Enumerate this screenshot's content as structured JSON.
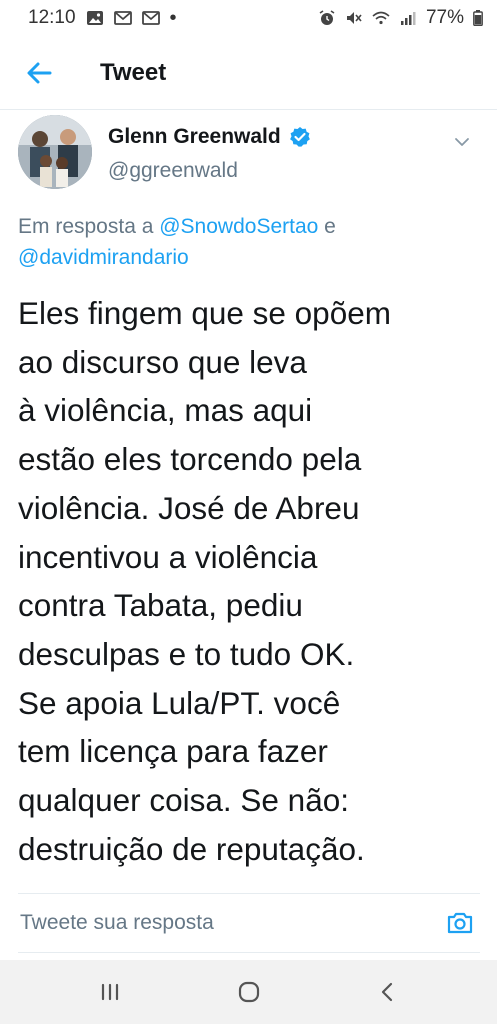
{
  "status_bar": {
    "time": "12:10",
    "notification_icons": [
      "photo-icon",
      "gmail-icon",
      "gmail-icon"
    ],
    "more_dot": "•",
    "battery": "77%",
    "system_icons": [
      "alarm-icon",
      "mute-icon",
      "wifi-icon",
      "signal-icon",
      "battery-icon"
    ]
  },
  "header": {
    "back_icon": "arrow-left-icon",
    "title": "Tweet"
  },
  "tweet": {
    "author_name": "Glenn Greenwald",
    "verified": true,
    "handle": "@ggreenwald",
    "reply_prefix": "Em resposta a ",
    "reply_mention_1": "@SnowdoSertao",
    "reply_conjunction": " e",
    "reply_mention_2": "@davidmirandario",
    "text_lines": [
      "Eles fingem que se opõem",
      "ao discurso que leva",
      "à violência, mas aqui",
      "estão eles torcendo pela",
      "violência. José de Abreu",
      "incentivou a violência",
      "contra Tabata, pediu",
      "desculpas e to tudo OK.",
      "Se apoia Lula/PT. você",
      "tem licença para fazer",
      "qualquer coisa. Se não:",
      "destruição de reputação."
    ]
  },
  "reply_bar": {
    "placeholder": "Tweete sua resposta",
    "camera_icon": "camera-icon"
  },
  "nav_bar": {
    "icons": [
      "recent-apps-icon",
      "home-icon",
      "back-icon"
    ]
  },
  "colors": {
    "accent": "#1da1f2",
    "text_primary": "#14171a",
    "text_secondary": "#657786",
    "divider": "#e6ecf0"
  }
}
